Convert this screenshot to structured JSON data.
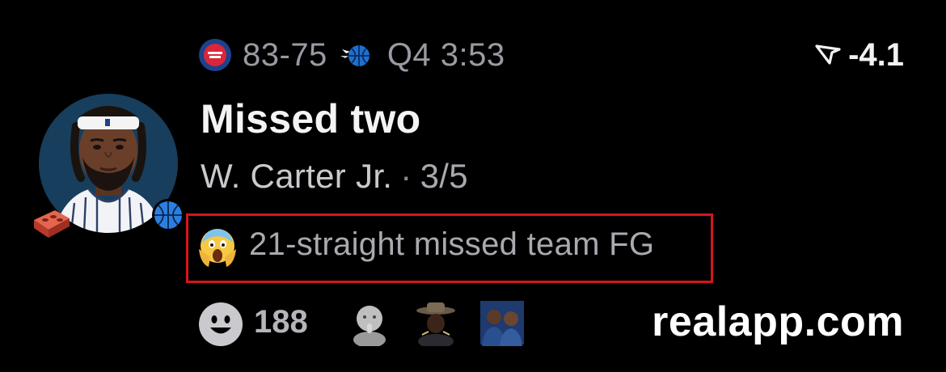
{
  "game": {
    "home_logo": "pistons-logo",
    "score": "83-75",
    "away_logo": "magic-logo",
    "clock": "Q4 3:53",
    "spread_icon": "betting-arrow-icon",
    "spread": "-4.1"
  },
  "play": {
    "title": "Missed two",
    "player": "W. Carter Jr.",
    "separator": "·",
    "stat": "3/5",
    "avatar": "player-avatar",
    "badges": [
      "brick-icon",
      "basketball-icon"
    ]
  },
  "note": {
    "emoji": "screaming-face-emoji",
    "text": "21-straight missed team FG",
    "highlight_color": "#d4161c"
  },
  "reactions": {
    "icon": "smiley-icon",
    "count": "188",
    "reactor_stickers": [
      "baby-sticker",
      "cowboy-hat-sticker",
      "two-men-sticker"
    ]
  },
  "watermark": "realapp.com"
}
